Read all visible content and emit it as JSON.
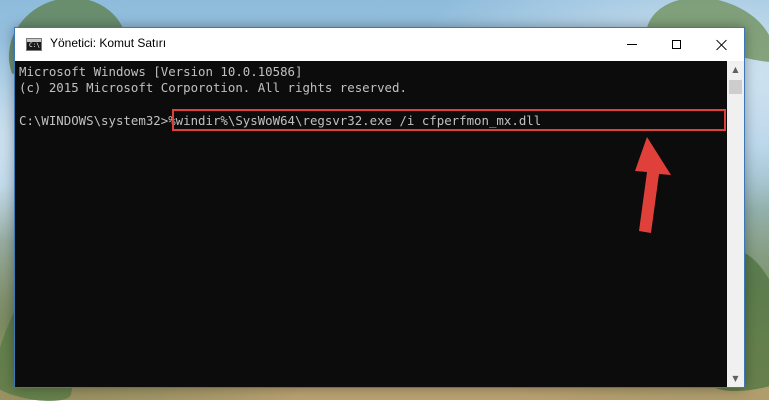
{
  "window": {
    "title": "Yönetici: Komut Satırı",
    "buttons": {
      "minimize_icon": "minimize-icon",
      "maximize_icon": "maximize-icon",
      "close_icon": "close-icon"
    }
  },
  "console": {
    "lines": [
      "Microsoft Windows [Version 10.0.10586]",
      "(c) 2015 Microsoft Corporotion. All rights reserved.",
      ""
    ],
    "prompt": "C:\\WINDOWS\\system32>",
    "command": "%windir%\\SysWoW64\\regsvr32.exe /i cfperfmon_mx.dll",
    "background_color": "#0c0c0c",
    "text_color": "#c0c0c0"
  },
  "annotation": {
    "highlight_color": "#e0403a",
    "arrow_color": "#e0403a"
  }
}
